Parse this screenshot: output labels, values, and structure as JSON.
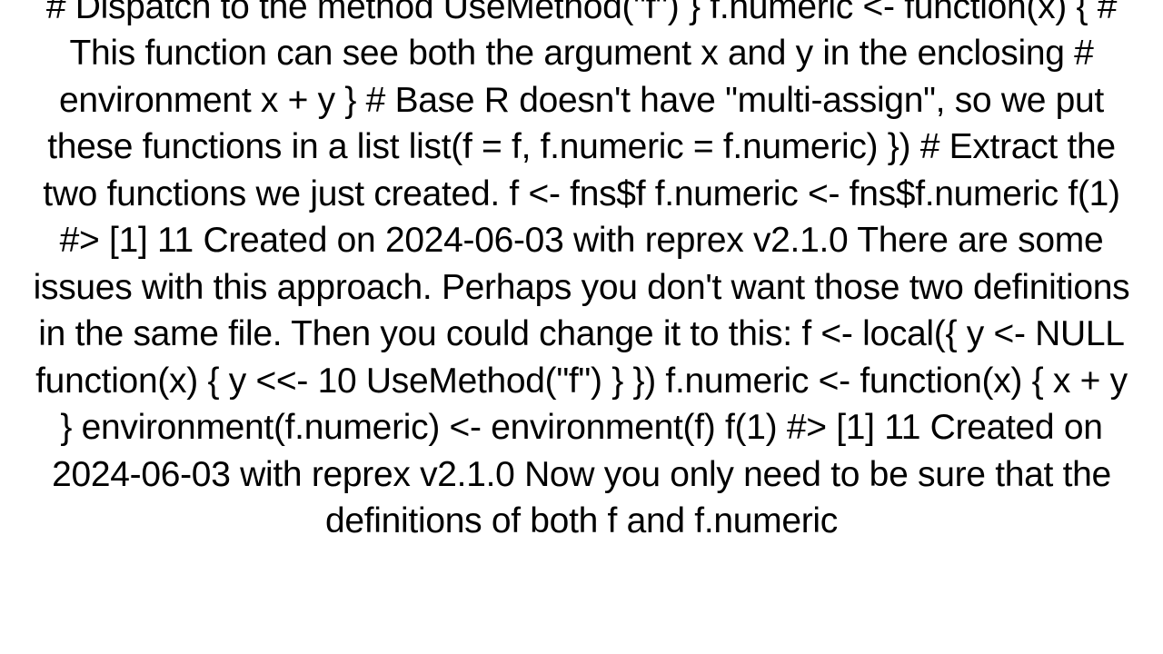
{
  "document": {
    "text": "# Dispatch to the method     UseMethod(\"f\")   }    f.numeric <- function(x) {     # This function can see both the argument x and y in the enclosing     # environment     x + y   }    # Base R doesn't have \"multi-assign\", so we put these functions in a list   list(f = f, f.numeric = f.numeric) })  # Extract the two functions we just created. f <- fns$f f.numeric <- fns$f.numeric  f(1) #> [1] 11  Created on 2024-06-03 with reprex v2.1.0 There are some issues with this approach.  Perhaps you don't want those two definitions in the same file.  Then you could change it to this: f <- local({   y <- NULL      function(x) {     y <<- 10     UseMethod(\"f\")   } })  f.numeric <- function(x) {   x + y } environment(f.numeric) <- environment(f)  f(1) #> [1] 11  Created on 2024-06-03 with reprex v2.1.0 Now you only need to be sure that the definitions of both f and f.numeric"
  }
}
